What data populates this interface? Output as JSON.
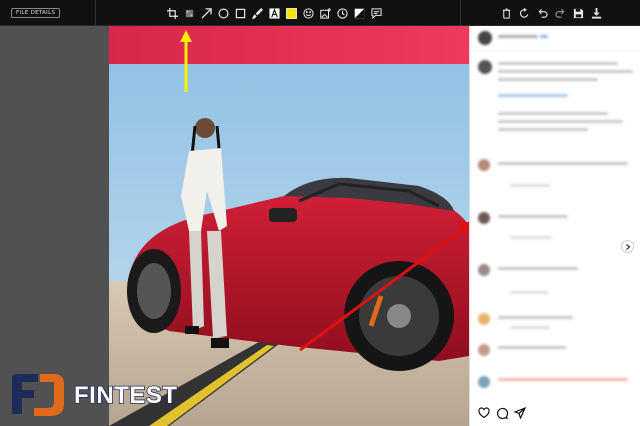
{
  "toolbar": {
    "file_details_label": "FILE DETAILS",
    "tools": [
      "crop-icon",
      "blur-icon",
      "arrow-icon",
      "ellipse-icon",
      "rectangle-icon",
      "brush-icon",
      "text-icon",
      "highlight-icon",
      "emoji-icon",
      "add-image-icon",
      "timer-icon",
      "contrast-icon",
      "comment-icon"
    ],
    "actions": [
      "delete-icon",
      "rotate-icon",
      "undo-icon",
      "redo-icon",
      "save-icon",
      "download-icon"
    ],
    "highlight_color": "#f2e600"
  },
  "annotations": {
    "arrow_yellow_color": "#ffee00",
    "arrow_red_color": "#e01010"
  },
  "photo": {
    "sky_color": "#9fc9e6",
    "car_color": "#c0182e",
    "banner_color": "#e2264b"
  },
  "side_panel": {
    "post_icons": [
      "like-icon",
      "comment-icon",
      "share-icon"
    ]
  },
  "logo": {
    "text": "FINTEST",
    "mark": "FJ",
    "primary_color": "#1e2a5a",
    "accent_color": "#e06a1a"
  }
}
